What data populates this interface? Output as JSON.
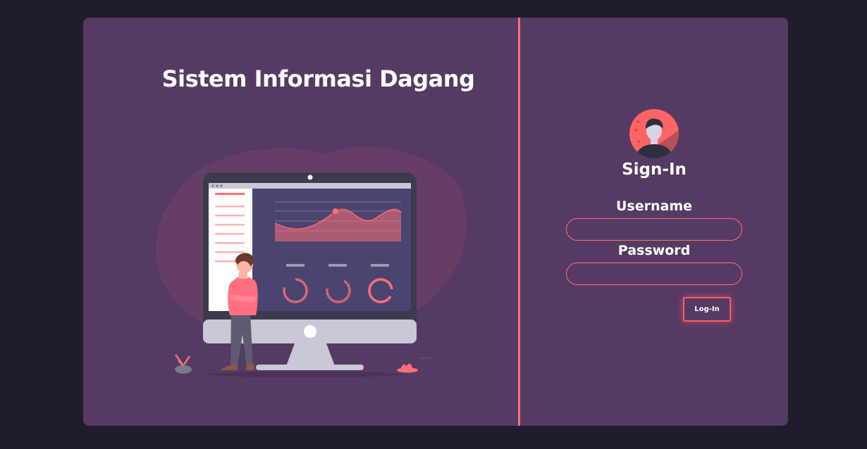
{
  "header": {
    "title": "Sistem Informasi Dagang"
  },
  "login": {
    "title": "Sign-In",
    "username_label": "Username",
    "username_value": "",
    "password_label": "Password",
    "password_value": "",
    "button_label": "Log-In"
  },
  "colors": {
    "background": "#1f1d2c",
    "card": "#553a63",
    "accent": "#ff6f73",
    "monitor_screen": "#4a4470",
    "monitor_body": "#c8c8d6"
  },
  "icons": {
    "avatar": "user-avatar-icon",
    "illustration": "dashboard-monitor-illustration"
  }
}
